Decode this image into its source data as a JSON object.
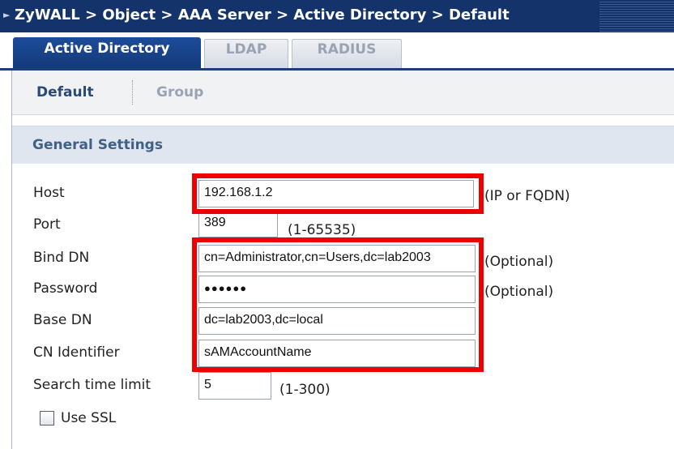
{
  "titlebar": {
    "path": "ZyWALL > Object > AAA Server > Active Directory > Default"
  },
  "top_tabs": [
    {
      "label": "Active Directory",
      "active": true
    },
    {
      "label": "LDAP",
      "active": false
    },
    {
      "label": "RADIUS",
      "active": false
    }
  ],
  "sub_tabs": [
    {
      "label": "Default",
      "active": true
    },
    {
      "label": "Group",
      "active": false
    }
  ],
  "section": {
    "title": "General Settings"
  },
  "form": {
    "host": {
      "label": "Host",
      "value": "192.168.1.2",
      "hint": "(IP or FQDN)"
    },
    "port": {
      "label": "Port",
      "value": "389",
      "hint": "(1-65535)"
    },
    "bind_dn": {
      "label": "Bind DN",
      "value": "cn=Administrator,cn=Users,dc=lab2003",
      "hint": "(Optional)"
    },
    "password": {
      "label": "Password",
      "value": "●●●●●●",
      "hint": "(Optional)"
    },
    "base_dn": {
      "label": "Base DN",
      "value": "dc=lab2003,dc=local"
    },
    "cn_identifier": {
      "label": "CN Identifier",
      "value": "sAMAccountName"
    },
    "search_time_limit": {
      "label": "Search time limit",
      "value": "5",
      "hint": "(1-300)"
    },
    "use_ssl": {
      "label": "Use SSL",
      "checked": false
    }
  },
  "colors": {
    "titlebar": "#14336b",
    "active_tab": "#1d4c9a",
    "section_header": "#dfe6f0",
    "highlight": "#ee0000"
  }
}
